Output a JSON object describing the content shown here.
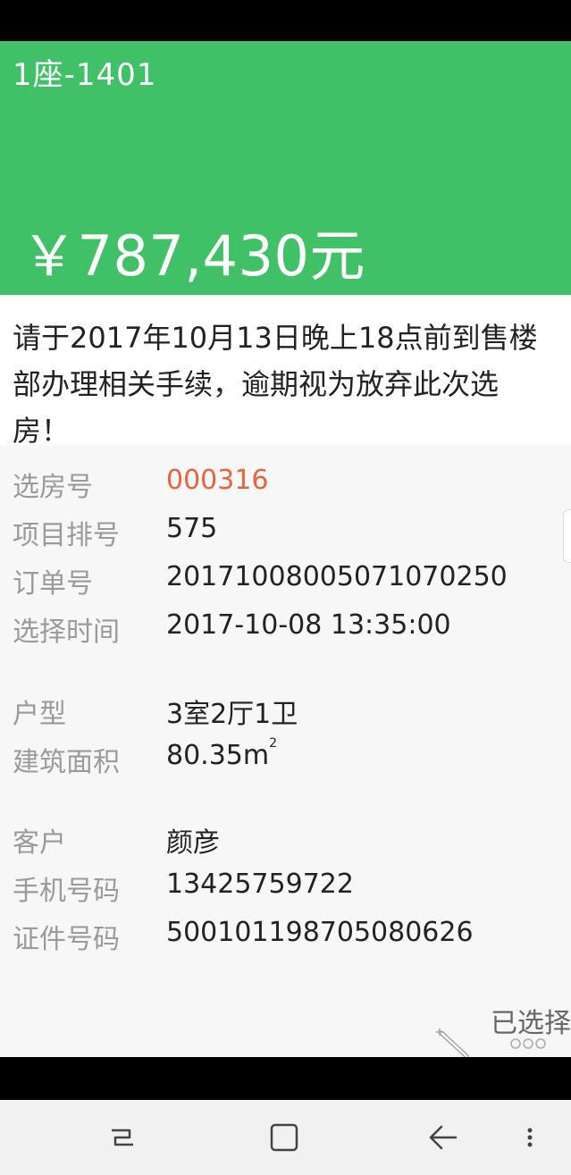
{
  "header": {
    "room_id": "1座-1401",
    "price": "￥787,430元",
    "background_color": "#40c168"
  },
  "notice": {
    "text": "请于2017年10月13日晚上18点前到售楼部办理相关手续，逾期视为放弃此次选房！"
  },
  "details": {
    "selection_number": {
      "label": "选房号",
      "value": "000316",
      "value_color": "#e6643c"
    },
    "project_rank": {
      "label": "项目排号",
      "value": "575"
    },
    "order_number": {
      "label": "订单号",
      "value": "20171008005071070250"
    },
    "selection_time": {
      "label": "选择时间",
      "value": "2017-10-08 13:35:00"
    },
    "layout": {
      "label": "户型",
      "value": "3室2厅1卫"
    },
    "floor_area": {
      "label": "建筑面积",
      "value": "80.35m",
      "unit_sup": "2"
    },
    "customer": {
      "label": "客户",
      "value": "颜彦"
    },
    "phone": {
      "label": "手机号码",
      "value": "13425759722"
    },
    "id_number": {
      "label": "证件号码",
      "value": "500101198705080626"
    }
  },
  "actions": {
    "chosen_label": "已选择"
  },
  "icons": {
    "magic": "magic-wand-icon",
    "more": "more-dots-icon",
    "recent": "recent-apps-icon",
    "home": "home-icon",
    "back": "back-icon",
    "menu": "vertical-dots-icon"
  }
}
